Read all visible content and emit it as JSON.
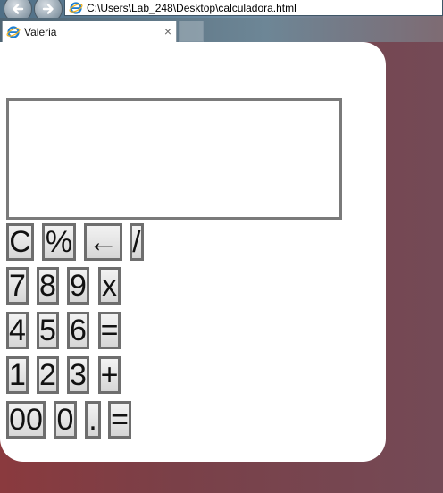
{
  "browser": {
    "address": "C:\\Users\\Lab_248\\Desktop\\calculadora.html",
    "tab_title": "Valeria",
    "tab_close": "×"
  },
  "calculator": {
    "display_value": "",
    "rows": [
      [
        "C",
        "%",
        "←",
        "/"
      ],
      [
        "7",
        "8",
        "9",
        "x"
      ],
      [
        "4",
        "5",
        "6",
        "="
      ],
      [
        "1",
        "2",
        "3",
        "+"
      ],
      [
        "00",
        "0",
        ".",
        "="
      ]
    ]
  }
}
